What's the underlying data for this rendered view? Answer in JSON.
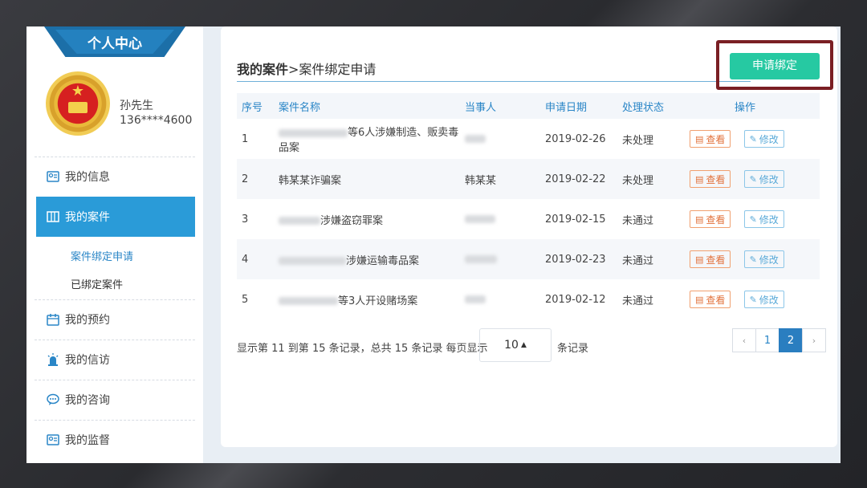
{
  "sidebar": {
    "banner_title": "个人中心",
    "user": {
      "name": "孙先生",
      "phone": "136****4600"
    },
    "nav": [
      {
        "label": "我的信息",
        "icon": "id-card-icon"
      },
      {
        "label": "我的案件",
        "icon": "grid-icon",
        "active": true
      },
      {
        "label": "我的预约",
        "icon": "calendar-icon"
      },
      {
        "label": "我的信访",
        "icon": "alarm-light-icon"
      },
      {
        "label": "我的咨询",
        "icon": "chat-bubble-icon"
      },
      {
        "label": "我的监督",
        "icon": "id-card-icon"
      }
    ],
    "subnav": [
      {
        "label": "案件绑定申请",
        "current": true
      },
      {
        "label": "已绑定案件"
      }
    ]
  },
  "breadcrumb": {
    "section": "我的案件",
    "separator": ">",
    "page": "案件绑定申请"
  },
  "apply_button_label": "申请绑定",
  "table": {
    "headers": [
      "序号",
      "案件名称",
      "当事人",
      "申请日期",
      "处理状态",
      "操作"
    ],
    "rows": [
      {
        "no": "1",
        "case_name": "等6人涉嫌制造、贩卖毒品案",
        "party": "",
        "date": "2019-02-26",
        "status": "未处理"
      },
      {
        "no": "2",
        "case_name": "韩某某诈骗案",
        "party": "韩某某",
        "date": "2019-02-22",
        "status": "未处理"
      },
      {
        "no": "3",
        "case_name": "涉嫌盗窃罪案",
        "party": "",
        "date": "2019-02-15",
        "status": "未通过"
      },
      {
        "no": "4",
        "case_name": "涉嫌运输毒品案",
        "party": "",
        "date": "2019-02-23",
        "status": "未通过"
      },
      {
        "no": "5",
        "case_name": "等3人开设赌场案",
        "party": "",
        "date": "2019-02-12",
        "status": "未通过"
      }
    ],
    "view_label": "查看",
    "edit_label": "修改"
  },
  "pagination": {
    "summary": "显示第 11 到第 15 条记录，总共 15 条记录 每页显示",
    "page_size": "10",
    "suffix": "条记录",
    "prev": "‹",
    "pages": [
      "1",
      "2"
    ],
    "current_page": "2",
    "next": "›"
  },
  "colors": {
    "accent": "#2a9bd8",
    "apply_button": "#26c9a2",
    "highlight_box": "#7a1f24"
  }
}
